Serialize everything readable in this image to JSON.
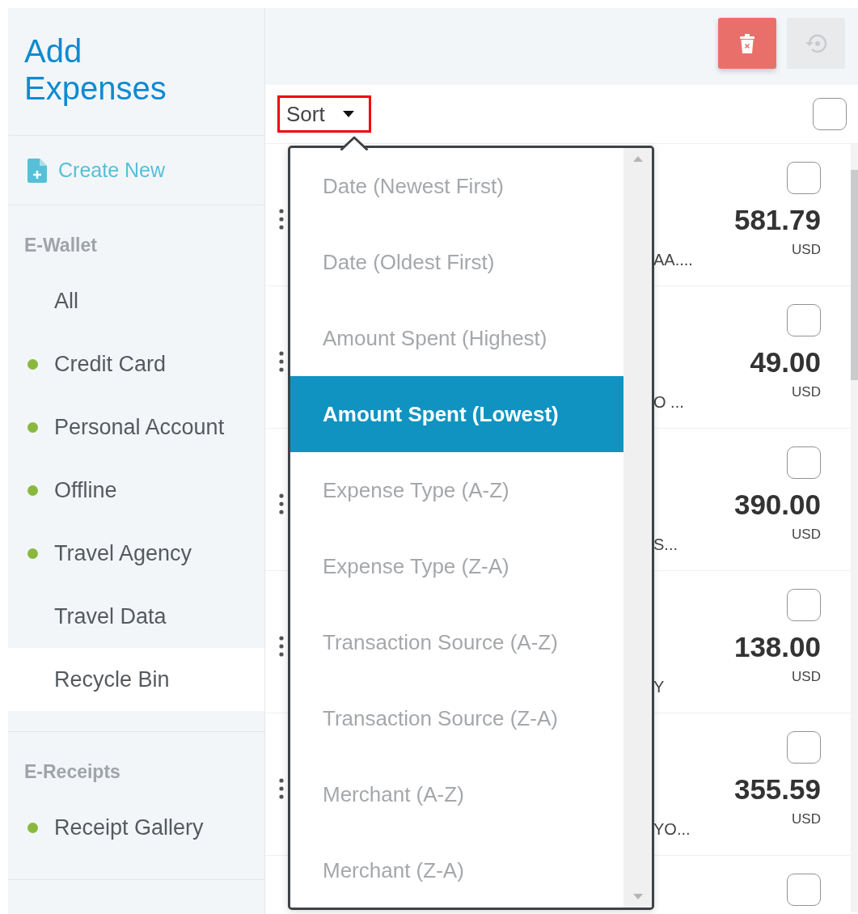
{
  "sidebar": {
    "title": "Add Expenses",
    "create_new": "Create New",
    "sections": [
      {
        "heading": "E-Wallet",
        "items": [
          {
            "label": "All",
            "selected": false
          },
          {
            "label": "Credit Card",
            "selected": false,
            "color": "#8ab83f"
          },
          {
            "label": "Personal Account",
            "selected": false,
            "color": "#8ab83f"
          },
          {
            "label": "Offline",
            "selected": false,
            "color": "#8ab83f"
          },
          {
            "label": "Travel Agency",
            "selected": false,
            "color": "#8ab83f"
          },
          {
            "label": "Travel Data",
            "selected": false
          },
          {
            "label": "Recycle Bin",
            "selected": true
          }
        ]
      },
      {
        "heading": "E-Receipts",
        "items": [
          {
            "label": "Receipt Gallery",
            "selected": false,
            "color": "#8ab83f"
          }
        ]
      }
    ]
  },
  "toolbar": [
    {
      "kind": "delete",
      "disabled": false
    },
    {
      "kind": "restore",
      "disabled": true
    }
  ],
  "sort": {
    "label": "Sort",
    "highlighted": true
  },
  "select_all": {
    "checked": false
  },
  "rows": [
    {
      "detail": "AA....",
      "amount": "581.79",
      "currency": "USD",
      "checked": false
    },
    {
      "detail": "O ...",
      "amount": "49.00",
      "currency": "USD",
      "checked": false
    },
    {
      "detail": "S...",
      "amount": "390.00",
      "currency": "USD",
      "checked": false
    },
    {
      "detail": "Y",
      "amount": "138.00",
      "currency": "USD",
      "checked": false
    },
    {
      "detail": "YO...",
      "amount": "355.59",
      "currency": "USD",
      "checked": false
    },
    {
      "checked": false
    }
  ],
  "sort_options": [
    {
      "label": "Date (Newest First)",
      "selected": false
    },
    {
      "label": "Date (Oldest First)",
      "selected": false
    },
    {
      "label": "Amount Spent (Highest)",
      "selected": false
    },
    {
      "label": "Amount Spent (Lowest)",
      "selected": true
    },
    {
      "label": "Expense Type (A-Z)",
      "selected": false
    },
    {
      "label": "Expense Type (Z-A)",
      "selected": false
    },
    {
      "label": "Transaction Source (A-Z)",
      "selected": false
    },
    {
      "label": "Transaction Source (Z-A)",
      "selected": false
    },
    {
      "label": "Merchant (A-Z)",
      "selected": false
    },
    {
      "label": "Merchant (Z-A)",
      "selected": false
    }
  ]
}
